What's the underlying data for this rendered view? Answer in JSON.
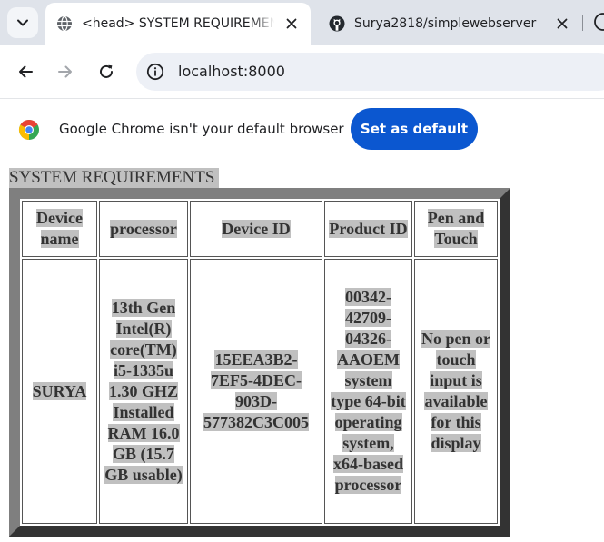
{
  "browser": {
    "tabs": [
      {
        "title": "<head> SYSTEM REQUIREMENTS",
        "active": true,
        "favicon": "globe-icon"
      },
      {
        "title": "Surya2818/simplewebserver",
        "active": false,
        "favicon": "github-icon"
      }
    ],
    "address_bar": {
      "url": "localhost:8000"
    },
    "infobar": {
      "message": "Google Chrome isn't your default browser",
      "button_label": "Set as default"
    }
  },
  "page": {
    "heading": "SYSTEM REQUIREMENTS",
    "table": {
      "headers": [
        "Device name",
        "processor",
        "Device ID",
        "Product ID",
        "Pen and Touch"
      ],
      "rows": [
        [
          "SURYA",
          "13th Gen Intel(R) core(TM) i5-1335u 1.30 GHZ Installed RAM 16.0 GB (15.7 GB usable)",
          "15EEA3B2-7EF5-4DEC-903D-577382C3C005",
          "00342-42709-04326-AAOEM system type 64-bit operating system, x64-based processor",
          "No pen or touch input is available for this display"
        ]
      ]
    }
  },
  "colors": {
    "tab_strip": "#dfe3ea",
    "omnibox": "#edf0f6",
    "primary_button": "#0b57d0",
    "text_highlight": "#c0c0c0",
    "table_border_light": "#7f7f7f",
    "table_border_dark": "#333333"
  }
}
